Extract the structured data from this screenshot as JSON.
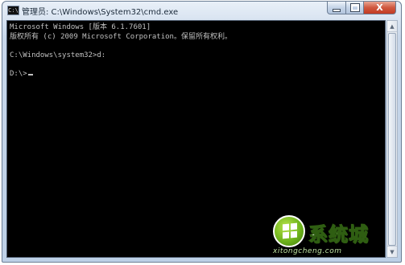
{
  "window": {
    "title": "管理员: C:\\Windows\\System32\\cmd.exe",
    "icon_label": "C:\\",
    "controls": {
      "minimize_icon": "minimize-icon",
      "maximize_icon": "maximize-icon",
      "close_label": "X"
    }
  },
  "console": {
    "lines": [
      "Microsoft Windows [版本 6.1.7601]",
      "版权所有 (c) 2009 Microsoft Corporation。保留所有权利。",
      "",
      "C:\\Windows\\system32>d:",
      "",
      "D:\\>"
    ],
    "background": "#000000",
    "foreground": "#c0c0c0"
  },
  "scrollbar": {
    "up_icon": "▲",
    "down_icon": "▼"
  },
  "watermark": {
    "text": "系统城",
    "url": "xitongcheng.com"
  }
}
